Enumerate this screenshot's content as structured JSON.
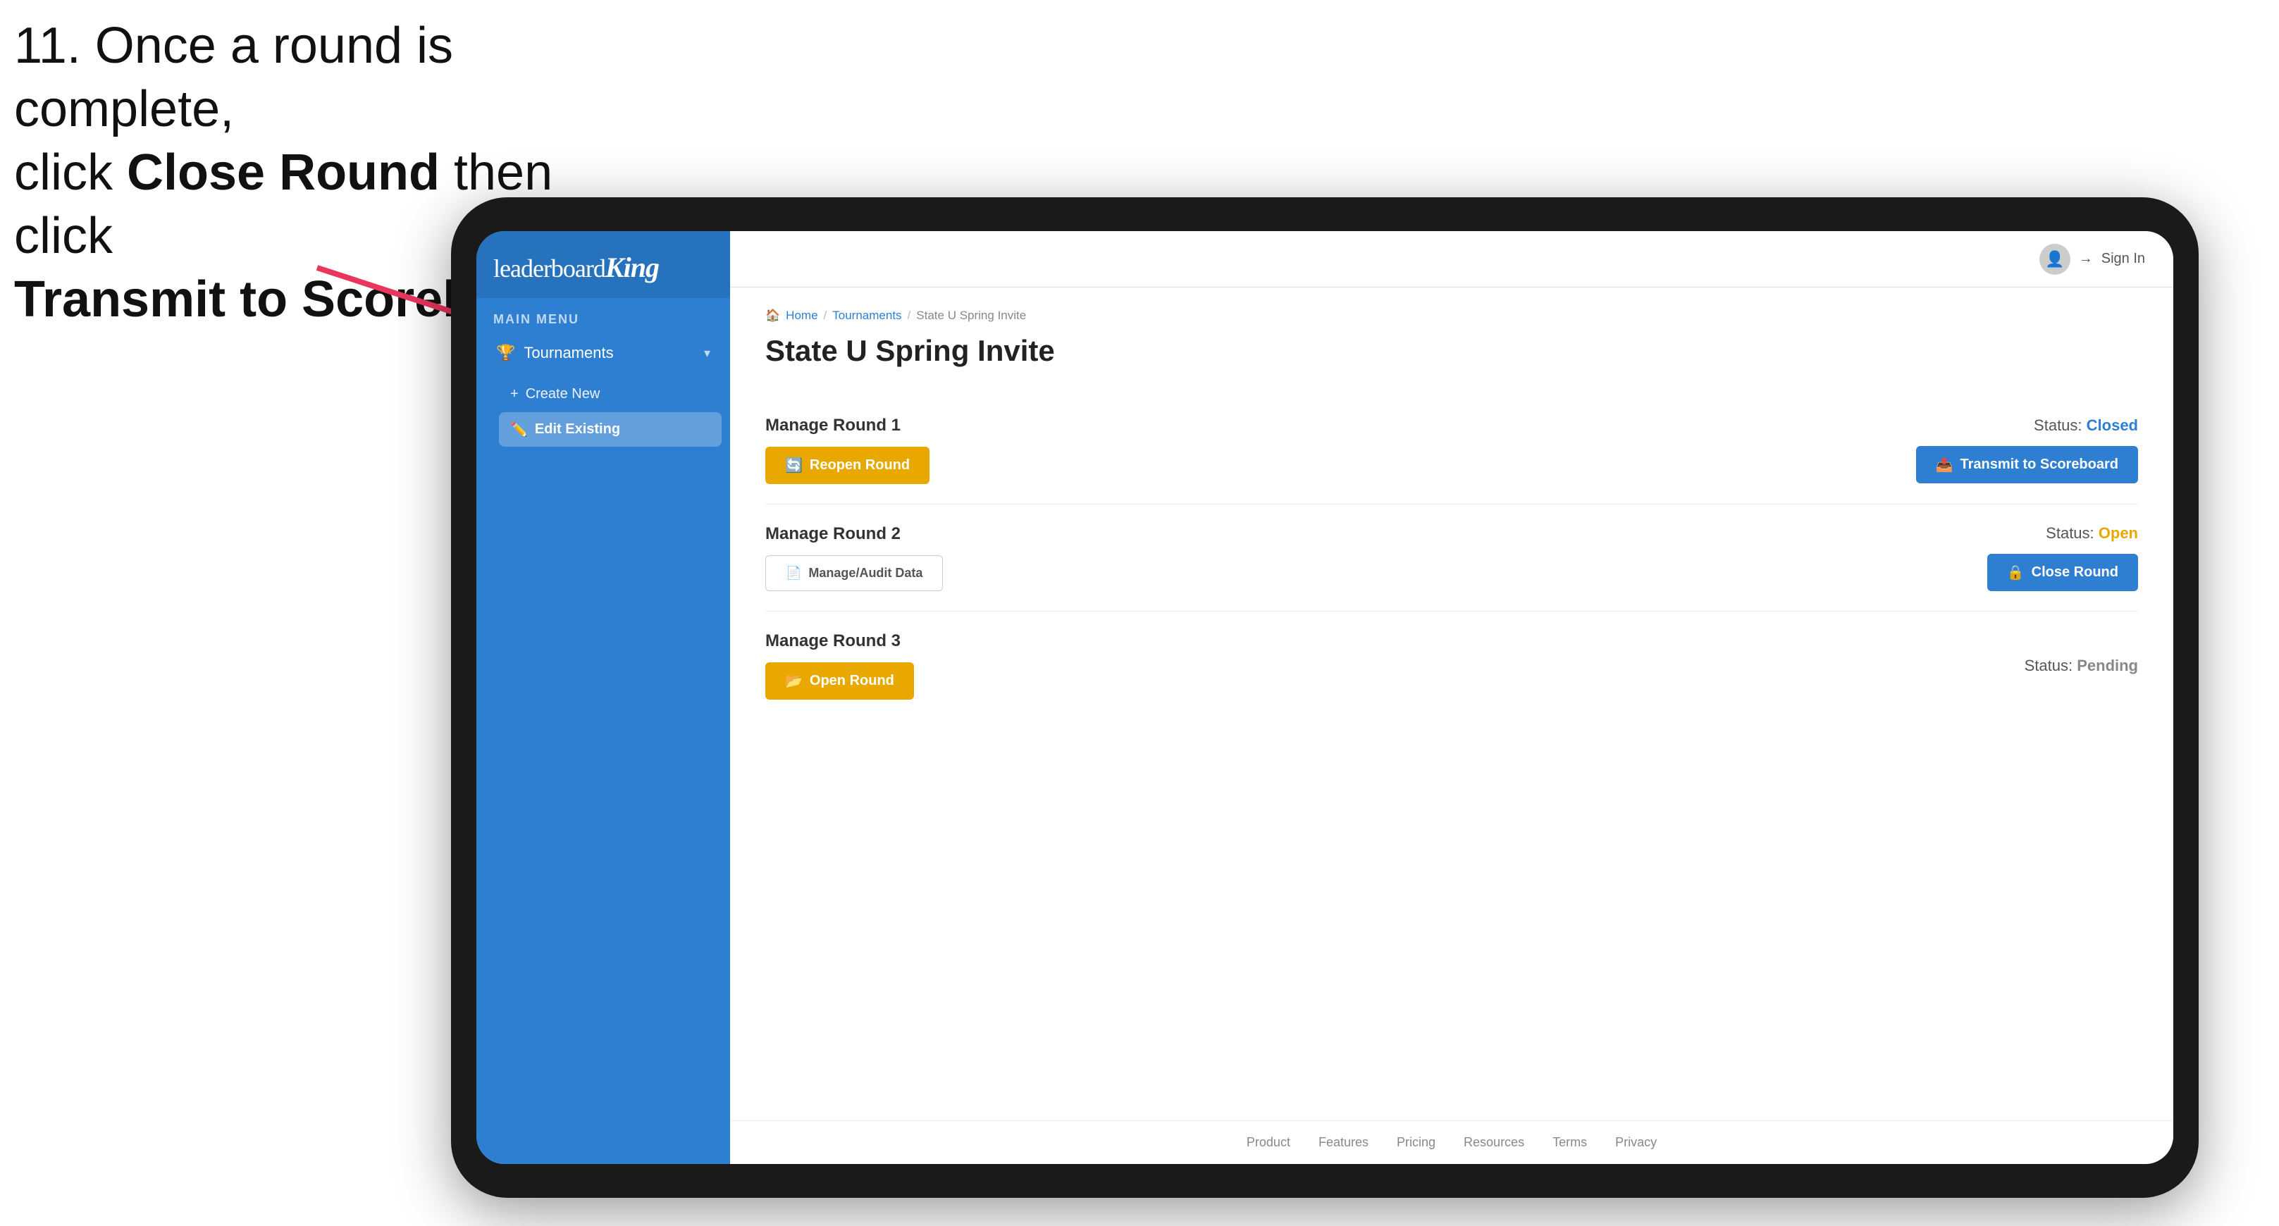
{
  "instruction": {
    "line1": "11. Once a round is complete,",
    "line2_prefix": "click ",
    "line2_bold": "Close Round",
    "line2_suffix": " then click",
    "line3_bold": "Transmit to Scoreboard."
  },
  "app": {
    "logo_leaderboard": "leaderboard",
    "logo_king": "King",
    "main_menu_label": "MAIN MENU",
    "sidebar": {
      "tournaments_label": "Tournaments",
      "create_new_label": "Create New",
      "edit_existing_label": "Edit Existing"
    },
    "header": {
      "sign_in_label": "Sign In"
    },
    "breadcrumb": {
      "home": "Home",
      "tournaments": "Tournaments",
      "current": "State U Spring Invite"
    },
    "page_title": "State U Spring Invite",
    "rounds": [
      {
        "id": "round1",
        "label": "Manage Round 1",
        "status_label": "Status:",
        "status_value": "Closed",
        "status_type": "closed",
        "primary_button": "Reopen Round",
        "primary_button_type": "amber",
        "secondary_button": "Transmit to Scoreboard",
        "secondary_button_type": "blue"
      },
      {
        "id": "round2",
        "label": "Manage Round 2",
        "status_label": "Status:",
        "status_value": "Open",
        "status_type": "open",
        "primary_button": "Manage/Audit Data",
        "primary_button_type": "outline",
        "secondary_button": "Close Round",
        "secondary_button_type": "blue"
      },
      {
        "id": "round3",
        "label": "Manage Round 3",
        "status_label": "Status:",
        "status_value": "Pending",
        "status_type": "pending",
        "primary_button": "Open Round",
        "primary_button_type": "amber",
        "secondary_button": null
      }
    ],
    "footer": {
      "links": [
        "Product",
        "Features",
        "Pricing",
        "Resources",
        "Terms",
        "Privacy"
      ]
    }
  }
}
